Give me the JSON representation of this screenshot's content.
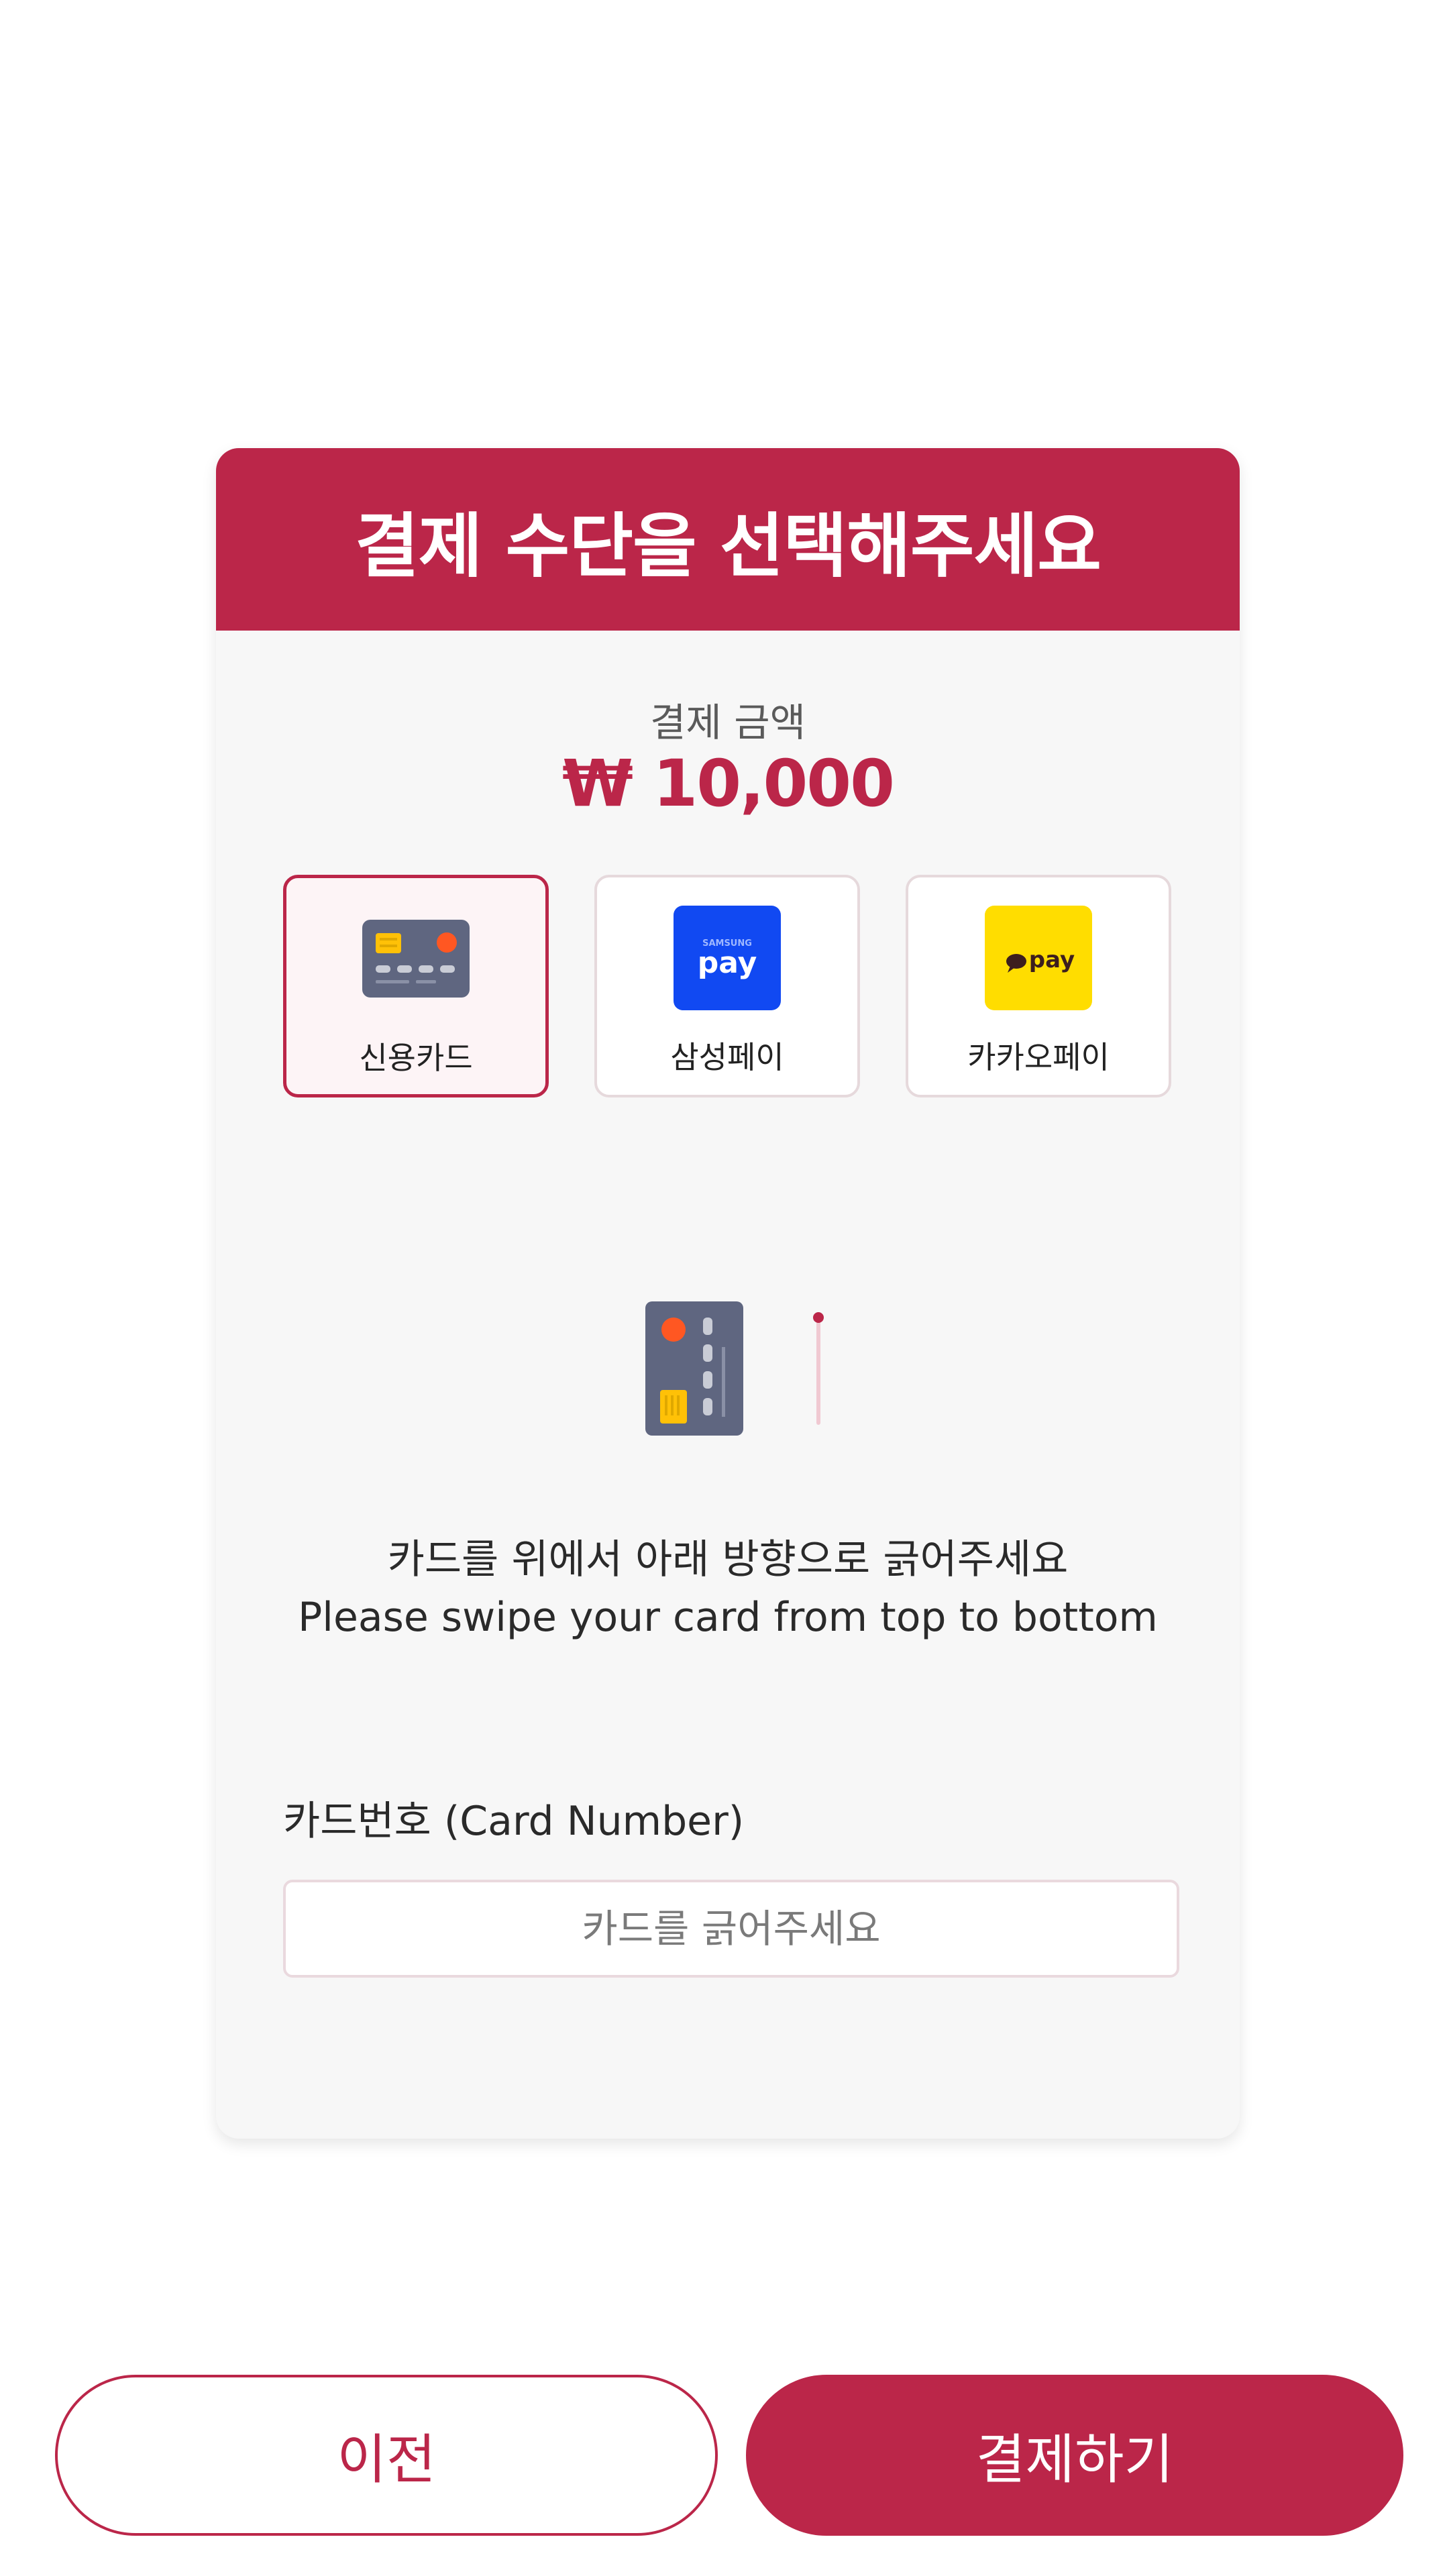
{
  "colors": {
    "accent": "#bb2649",
    "panel_bg": "#f7f7f7",
    "samsung_blue": "#1149f2",
    "kakao_yellow": "#ffdd00"
  },
  "header": {
    "title": "결제 수단을 선택해주세요"
  },
  "amount": {
    "label": "결제 금액",
    "value": "₩ 10,000"
  },
  "methods": [
    {
      "label": "신용카드",
      "icon": "credit-card-icon",
      "selected": true
    },
    {
      "label": "삼성페이",
      "icon": "samsung-pay-icon",
      "selected": false,
      "icon_text_small": "SAMSUNG",
      "icon_text": "pay"
    },
    {
      "label": "카카오페이",
      "icon": "kakao-pay-icon",
      "selected": false,
      "icon_text": "pay"
    }
  ],
  "instruction": {
    "ko": "카드를 위에서 아래 방향으로 긁어주세요",
    "en": "Please swipe your card from top to bottom"
  },
  "card_field": {
    "label": "카드번호 (Card Number)",
    "placeholder": "카드를 긁어주세요",
    "value": ""
  },
  "buttons": {
    "prev": "이전",
    "pay": "결제하기"
  }
}
